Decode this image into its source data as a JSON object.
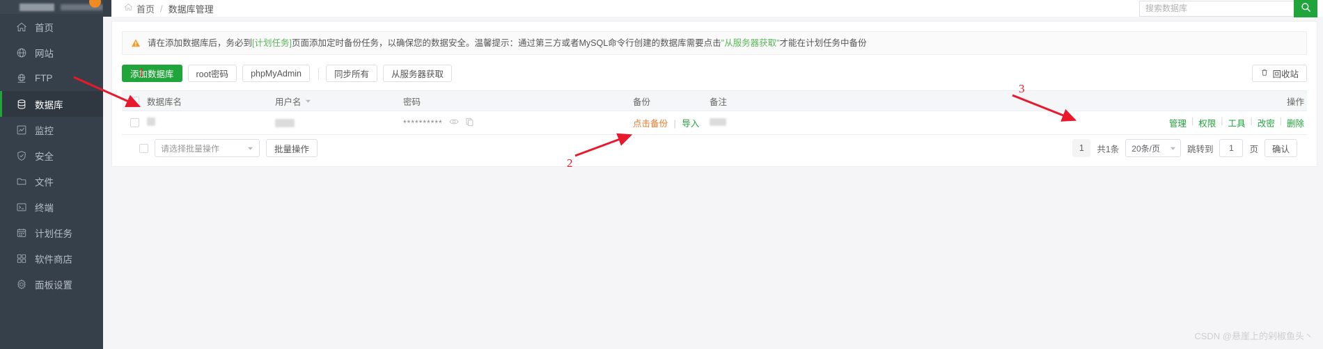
{
  "sidebar": {
    "items": [
      {
        "label": "首页",
        "icon": "home-icon",
        "active": false
      },
      {
        "label": "网站",
        "icon": "globe-icon",
        "active": false
      },
      {
        "label": "FTP",
        "icon": "ftp-icon",
        "active": false
      },
      {
        "label": "数据库",
        "icon": "database-icon",
        "active": true
      },
      {
        "label": "监控",
        "icon": "chart-icon",
        "active": false
      },
      {
        "label": "安全",
        "icon": "shield-icon",
        "active": false
      },
      {
        "label": "文件",
        "icon": "folder-icon",
        "active": false
      },
      {
        "label": "终端",
        "icon": "terminal-icon",
        "active": false
      },
      {
        "label": "计划任务",
        "icon": "calendar-icon",
        "active": false
      },
      {
        "label": "软件商店",
        "icon": "grid-icon",
        "active": false
      },
      {
        "label": "面板设置",
        "icon": "gear-icon",
        "active": false
      }
    ]
  },
  "header": {
    "breadcrumb_home": "首页",
    "breadcrumb_sep": "/",
    "breadcrumb_current": "数据库管理",
    "search_placeholder": "搜索数据库",
    "search_value": "",
    "search_icon": "search-icon"
  },
  "alert": {
    "icon": "warning-icon",
    "text_1": "请在添加数据库后，务必到",
    "link_1": "[计划任务]",
    "text_2": "页面添加定时备份任务，以确保您的数据安全。温馨提示：通过第三方或者MySQL命令行创建的数据库需要点击",
    "link_2": "\"从服务器获取\"",
    "text_3": "才能在计划任务中备份"
  },
  "toolbar": {
    "add_db": "添加数据库",
    "root_password": "root密码",
    "phpmyadmin": "phpMyAdmin",
    "sync_all": "同步所有",
    "fetch_from_server": "从服务器获取",
    "recycle_bin": "回收站",
    "recycle_icon": "trash-icon"
  },
  "table": {
    "columns": [
      "数据库名",
      "用户名",
      "密码",
      "备份",
      "备注",
      "操作"
    ],
    "sort_icon": "sort-caret-icon",
    "rows": [
      {
        "db_name": "",
        "user_name": "",
        "password_mask": "**********",
        "eye_icon": "eye-icon",
        "copy_icon": "copy-icon",
        "backup_link": "点击备份",
        "backup_sep": "|",
        "import_link": "导入",
        "note": "",
        "actions": [
          "管理",
          "权限",
          "工具",
          "改密",
          "删除"
        ]
      }
    ]
  },
  "footer": {
    "batch_select_placeholder": "请选择批量操作",
    "batch_button": "批量操作",
    "current_page": "1",
    "total_text": "共1条",
    "per_page": "20条/页",
    "jump_label": "跳转到",
    "jump_value": "1",
    "page_unit": "页",
    "confirm": "确认"
  },
  "annotations": [
    {
      "number": "1"
    },
    {
      "number": "2"
    },
    {
      "number": "3"
    }
  ],
  "watermark": "CSDN @悬崖上的剁椒鱼头丶",
  "colors": {
    "accent_green": "#20a53a",
    "sidebar_bg": "#36404a",
    "annotation_red": "#e8192c",
    "backup_orange": "#e8792b"
  }
}
